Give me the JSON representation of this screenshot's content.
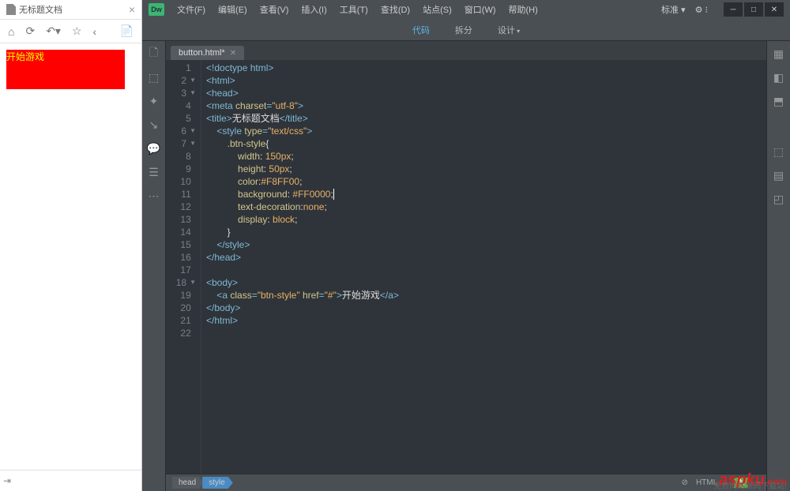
{
  "preview": {
    "tab_title": "无标题文档",
    "button_text": "开始游戏"
  },
  "menubar": {
    "logo": "Dw",
    "items": [
      "文件(F)",
      "编辑(E)",
      "查看(V)",
      "插入(I)",
      "工具(T)",
      "查找(D)",
      "站点(S)",
      "窗口(W)",
      "帮助(H)"
    ],
    "layout_label": "标准"
  },
  "view_tabs": {
    "code": "代码",
    "split": "拆分",
    "design": "设计"
  },
  "file_tab": {
    "name": "button.html*"
  },
  "code": {
    "lines": [
      {
        "n": 1,
        "html": "<span class='tag'>&lt;!doctype html&gt;</span>"
      },
      {
        "n": 2,
        "fold": true,
        "html": "<span class='tag'>&lt;html&gt;</span>"
      },
      {
        "n": 3,
        "fold": true,
        "html": "<span class='tag'>&lt;head&gt;</span>"
      },
      {
        "n": 4,
        "html": "<span class='tag'>&lt;meta </span><span class='attr'>charset</span><span class='tag'>=</span><span class='val'>\"utf-8\"</span><span class='tag'>&gt;</span>"
      },
      {
        "n": 5,
        "html": "<span class='tag'>&lt;title&gt;</span><span class='text'>无标题文档</span><span class='tag'>&lt;/title&gt;</span>"
      },
      {
        "n": 6,
        "fold": true,
        "html": "    <span class='tag'>&lt;style </span><span class='attr'>type</span><span class='tag'>=</span><span class='val'>\"text/css\"</span><span class='tag'>&gt;</span>"
      },
      {
        "n": 7,
        "fold": true,
        "html": "        <span class='prop'>.btn-style</span><span class='text'>{</span>"
      },
      {
        "n": 8,
        "html": "            <span class='prop'>width</span><span class='text'>: </span><span class='pval'>150px</span><span class='text'>;</span>"
      },
      {
        "n": 9,
        "html": "            <span class='prop'>height</span><span class='text'>: </span><span class='pval'>50px</span><span class='text'>;</span>"
      },
      {
        "n": 10,
        "html": "            <span class='prop'>color</span><span class='text'>:</span><span class='pval'>#F8FF00</span><span class='text'>;</span>"
      },
      {
        "n": 11,
        "html": "            <span class='prop'>background</span><span class='text'>: </span><span class='pval'>#FF0000</span><span class='text'>;</span><span class='cursor'></span>"
      },
      {
        "n": 12,
        "html": "            <span class='prop'>text-decoration</span><span class='text'>:</span><span class='pval'>none</span><span class='text'>;</span>"
      },
      {
        "n": 13,
        "html": "            <span class='prop'>display</span><span class='text'>: </span><span class='pval'>block</span><span class='text'>;</span>"
      },
      {
        "n": 14,
        "html": "        <span class='text'>}</span>"
      },
      {
        "n": 15,
        "html": "    <span class='tag'>&lt;/style&gt;</span>"
      },
      {
        "n": 16,
        "html": "<span class='tag'>&lt;/head&gt;</span>"
      },
      {
        "n": 17,
        "html": ""
      },
      {
        "n": 18,
        "fold": true,
        "html": "<span class='tag'>&lt;body&gt;</span>"
      },
      {
        "n": 19,
        "html": "    <span class='tag'>&lt;a </span><span class='attr'>class</span><span class='tag'>=</span><span class='val'>\"btn-style\"</span><span class='tag'> </span><span class='attr'>href</span><span class='tag'>=</span><span class='val'>\"#\"</span><span class='tag'>&gt;</span><span class='text'>开始游戏</span><span class='tag'>&lt;/a&gt;</span>"
      },
      {
        "n": 20,
        "html": "<span class='tag'>&lt;/body&gt;</span>"
      },
      {
        "n": 21,
        "html": "<span class='tag'>&lt;/html&gt;</span>"
      },
      {
        "n": 22,
        "html": ""
      }
    ]
  },
  "breadcrumb": {
    "items": [
      "head",
      "style"
    ]
  },
  "status": {
    "lang": "HTML",
    "ins": "IN"
  },
  "watermark": {
    "text1": "asp",
    "text2": "ku",
    "text3": ".com",
    "sub": "免费网站源码下载站!"
  }
}
